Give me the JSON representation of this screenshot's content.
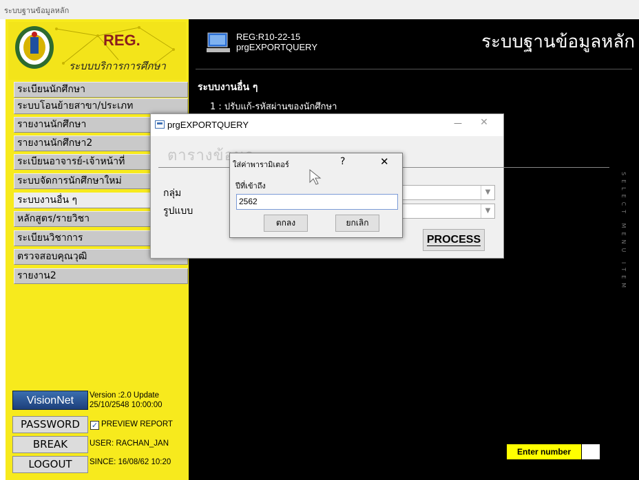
{
  "window": {
    "title": "ระบบฐานข้อมูลหลัก"
  },
  "logo": {
    "text1": "REG.",
    "text2": "ระบบบริการการศึกษา"
  },
  "sidebar": {
    "items": [
      {
        "label": "ระเบียนนักศึกษา"
      },
      {
        "label": "ระบบโอนย้ายสาขา/ประเภท"
      },
      {
        "label": "รายงานนักศึกษา"
      },
      {
        "label": "รายงานนักศึกษา2"
      },
      {
        "label": "ระเบียนอาจารย์-เจ้าหน้าที่"
      },
      {
        "label": "ระบบจัดการนักศึกษาใหม่"
      },
      {
        "label": "ระบบงานอื่น ๆ"
      },
      {
        "label": "หลักสูตร/รายวิชา"
      },
      {
        "label": "ระเบียนวิชาการ"
      },
      {
        "label": "ตรวจสอบคุณวุฒิ"
      },
      {
        "label": "รายงาน2"
      }
    ],
    "active_index": 6,
    "brand": "VisionNet",
    "version": "Version :2.0 Update",
    "version_date": "25/10/2548 10:00:00",
    "buttons": {
      "password": "PASSWORD",
      "break": "BREAK",
      "logout": "LOGOUT"
    },
    "preview_report": "PREVIEW REPORT",
    "preview_checked": true,
    "user": "USER: RACHAN_JAN",
    "since": "SINCE: 16/08/62 10:20"
  },
  "main": {
    "app_code": "REG:R10-22-15",
    "program": "prgEXPORTQUERY",
    "title": "ระบบฐานข้อมูลหลัก",
    "section": "ระบบงานอื่น ๆ",
    "item1": "1 : ปรับแก้-รหัสผ่านของนักศึกษา",
    "vertical_text": "SELECT MENU ITEM",
    "enter_number_label": "Enter number"
  },
  "dialog": {
    "title": "prgEXPORTQUERY",
    "heading": "ตารางข้อมูล",
    "group_label": "กลุ่ม",
    "format_label": "รูปแบบ",
    "process_label": "PROCESS"
  },
  "param_dialog": {
    "title": "ใส่ค่าพารามิเตอร์",
    "help": "?",
    "close": "✕",
    "prompt": "ปีที่เข้าถึง",
    "value": "2562",
    "ok": "ตกลง",
    "cancel": "ยกเลิก"
  },
  "colors": {
    "sidebar": "#f7ea1d",
    "main_bg": "#000000",
    "active_marker": "#ff6a00",
    "enter_bg": "#ffff00"
  }
}
